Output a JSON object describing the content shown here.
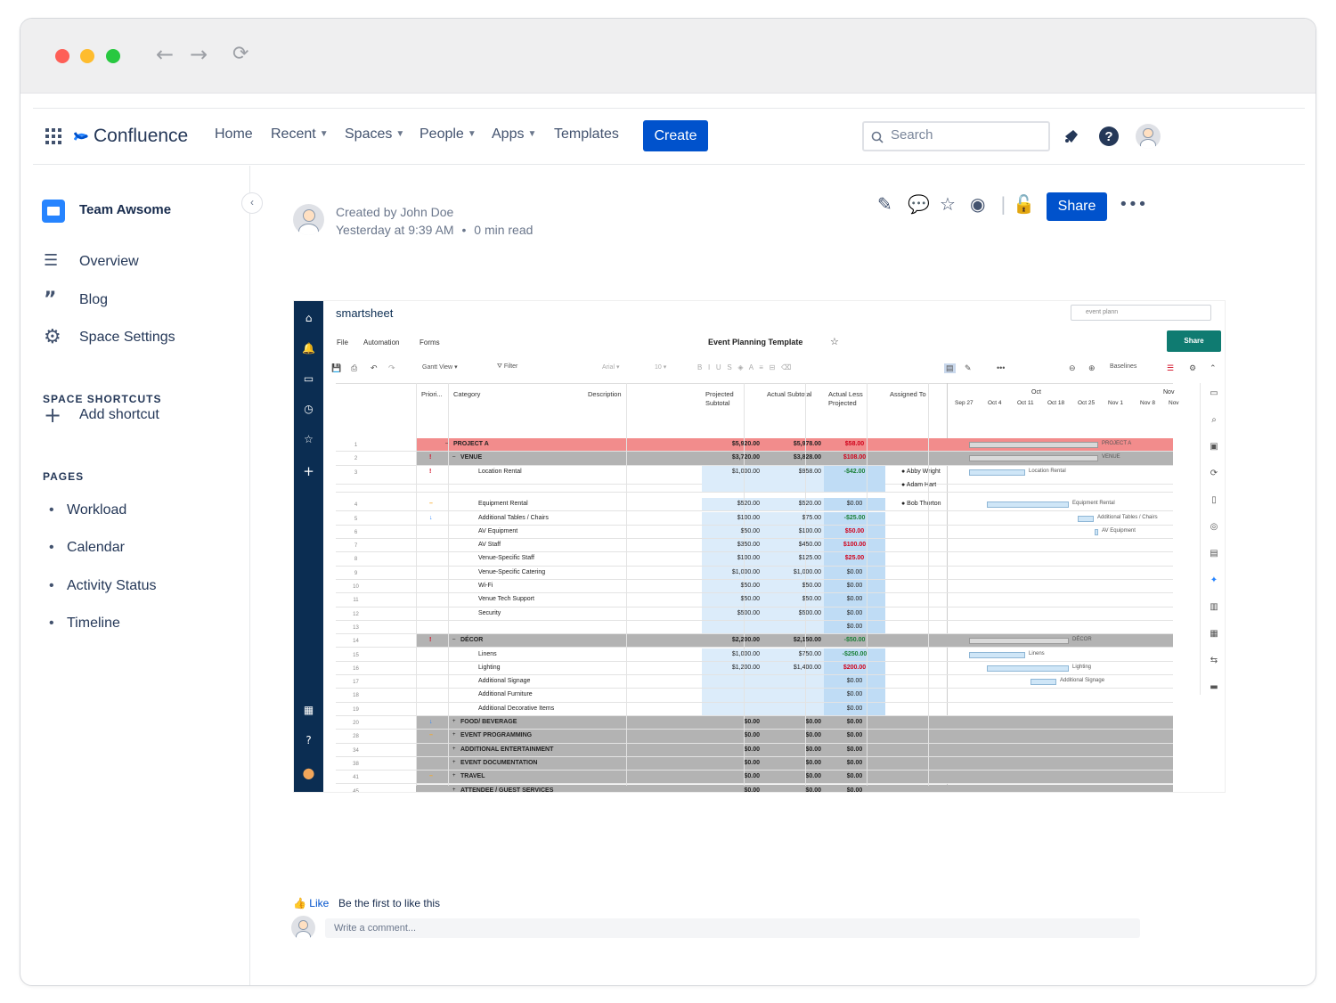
{
  "browser": {
    "back": "←",
    "forward": "→",
    "reload": "⟳"
  },
  "nav": {
    "logo": "Confluence",
    "home": "Home",
    "recent": "Recent",
    "spaces": "Spaces",
    "people": "People",
    "apps": "Apps",
    "templates": "Templates",
    "create": "Create",
    "search_placeholder": "Search"
  },
  "sidebar": {
    "space_name": "Team Awsome",
    "items": [
      {
        "label": "Overview"
      },
      {
        "label": "Blog"
      },
      {
        "label": "Space Settings"
      }
    ],
    "shortcuts_head": "SPACE SHORTCUTS",
    "add_shortcut": "Add shortcut",
    "pages_head": "PAGES",
    "pages": [
      {
        "label": "Workload"
      },
      {
        "label": "Calendar"
      },
      {
        "label": "Activity Status"
      },
      {
        "label": "Timeline"
      }
    ]
  },
  "page": {
    "created_by": "Created by John Doe",
    "timestamp": "Yesterday at 9:39 AM",
    "read_time": "0 min read",
    "share": "Share"
  },
  "smartsheet": {
    "brand": "smartsheet",
    "search_value": "event plann",
    "menu": [
      "File",
      "Automation",
      "Forms"
    ],
    "title": "Event Planning Template",
    "share": "Share",
    "toolbar": {
      "view": "Gantt View",
      "filter": "Filter",
      "font": "Arial",
      "size": "10",
      "baselines": "Baselines"
    },
    "headers": {
      "priority": "Priori...",
      "category": "Category",
      "description": "Description",
      "projected": "Projected Subtotal",
      "actual": "Actual Subtotal",
      "actual_less": "Actual Less Projected",
      "assigned": "Assigned To"
    },
    "gantt_months": [
      "Oct",
      "Nov"
    ],
    "gantt_weeks": [
      "Sep 27",
      "Oct 4",
      "Oct 11",
      "Oct 18",
      "Oct 25",
      "Nov 1",
      "Nov 8",
      "Nov"
    ],
    "rows": [
      {
        "n": "1",
        "cat": "PROJECT A",
        "ps": "$5,920.00",
        "as": "$5,978.00",
        "alp": "$58.00",
        "bar": "PROJECT A",
        "kind": "proj"
      },
      {
        "n": "2",
        "cat": "VENUE",
        "ps": "$3,720.00",
        "as": "$3,828.00",
        "alp": "$108.00",
        "bar": "VENUE",
        "kind": "group",
        "pri": "!"
      },
      {
        "n": "3",
        "cat": "Location Rental",
        "ps": "$1,000.00",
        "as": "$958.00",
        "alp": "-$42.00",
        "bar": "Location Rental",
        "kind": "child",
        "pri": "!",
        "asg": "Abby Wright"
      },
      {
        "n": "",
        "cat": "",
        "ps": "",
        "as": "",
        "alp": "",
        "bar": "",
        "kind": "child",
        "asg": "Adam Hart"
      },
      {
        "n": "4",
        "cat": "Equipment Rental",
        "ps": "$520.00",
        "as": "$520.00",
        "alp": "$0.00",
        "bar": "Equipment Rental",
        "kind": "child",
        "pri": "–",
        "asg": "Bob Thorton"
      },
      {
        "n": "5",
        "cat": "Additional Tables / Chairs",
        "ps": "$100.00",
        "as": "$75.00",
        "alp": "-$25.00",
        "bar": "Additional Tables / Chairs",
        "kind": "child",
        "pri": "↓"
      },
      {
        "n": "6",
        "cat": "AV Equipment",
        "ps": "$50.00",
        "as": "$100.00",
        "alp": "$50.00",
        "bar": "AV Equipment",
        "kind": "child"
      },
      {
        "n": "7",
        "cat": "AV Staff",
        "ps": "$350.00",
        "as": "$450.00",
        "alp": "$100.00",
        "bar": "",
        "kind": "child"
      },
      {
        "n": "8",
        "cat": "Venue-Specific Staff",
        "ps": "$100.00",
        "as": "$125.00",
        "alp": "$25.00",
        "bar": "",
        "kind": "child"
      },
      {
        "n": "9",
        "cat": "Venue-Specific Catering",
        "ps": "$1,000.00",
        "as": "$1,000.00",
        "alp": "$0.00",
        "bar": "",
        "kind": "child"
      },
      {
        "n": "10",
        "cat": "Wi-Fi",
        "ps": "$50.00",
        "as": "$50.00",
        "alp": "$0.00",
        "bar": "",
        "kind": "child"
      },
      {
        "n": "11",
        "cat": "Venue Tech Support",
        "ps": "$50.00",
        "as": "$50.00",
        "alp": "$0.00",
        "bar": "",
        "kind": "child"
      },
      {
        "n": "12",
        "cat": "Security",
        "ps": "$500.00",
        "as": "$500.00",
        "alp": "$0.00",
        "bar": "",
        "kind": "child"
      },
      {
        "n": "13",
        "cat": "",
        "ps": "",
        "as": "",
        "alp": "$0.00",
        "bar": "",
        "kind": "child"
      },
      {
        "n": "14",
        "cat": "DÉCOR",
        "ps": "$2,200.00",
        "as": "$2,150.00",
        "alp": "-$50.00",
        "bar": "DÉCOR",
        "kind": "group",
        "pri": "!"
      },
      {
        "n": "15",
        "cat": "Linens",
        "ps": "$1,000.00",
        "as": "$750.00",
        "alp": "-$250.00",
        "bar": "Linens",
        "kind": "child"
      },
      {
        "n": "16",
        "cat": "Lighting",
        "ps": "$1,200.00",
        "as": "$1,400.00",
        "alp": "$200.00",
        "bar": "Lighting",
        "kind": "child"
      },
      {
        "n": "17",
        "cat": "Additional Signage",
        "ps": "",
        "as": "",
        "alp": "$0.00",
        "bar": "Additional Signage",
        "kind": "child"
      },
      {
        "n": "18",
        "cat": "Additional Furniture",
        "ps": "",
        "as": "",
        "alp": "$0.00",
        "bar": "",
        "kind": "child"
      },
      {
        "n": "19",
        "cat": "Additional Decorative Items",
        "ps": "",
        "as": "",
        "alp": "$0.00",
        "bar": "",
        "kind": "child"
      },
      {
        "n": "20",
        "cat": "FOOD/ BEVERAGE",
        "ps": "$0.00",
        "as": "$0.00",
        "alp": "$0.00",
        "bar": "",
        "kind": "collapsed",
        "pri": "↓"
      },
      {
        "n": "28",
        "cat": "EVENT PROGRAMMING",
        "ps": "$0.00",
        "as": "$0.00",
        "alp": "$0.00",
        "bar": "",
        "kind": "collapsed",
        "pri": "–"
      },
      {
        "n": "34",
        "cat": "ADDITIONAL ENTERTAINMENT",
        "ps": "$0.00",
        "as": "$0.00",
        "alp": "$0.00",
        "bar": "",
        "kind": "collapsed"
      },
      {
        "n": "38",
        "cat": "EVENT DOCUMENTATION",
        "ps": "$0.00",
        "as": "$0.00",
        "alp": "$0.00",
        "bar": "",
        "kind": "collapsed"
      },
      {
        "n": "41",
        "cat": "TRAVEL",
        "ps": "$0.00",
        "as": "$0.00",
        "alp": "$0.00",
        "bar": "",
        "kind": "collapsed",
        "pri": "–"
      },
      {
        "n": "45",
        "cat": "ATTENDEE / GUEST SERVICES",
        "ps": "$0.00",
        "as": "$0.00",
        "alp": "$0.00",
        "bar": "",
        "kind": "collapsed"
      }
    ]
  },
  "footer": {
    "like": "Like",
    "like_text": "Be the first to like this",
    "comment_placeholder": "Write a comment..."
  },
  "colors": {
    "primary": "#0052cc",
    "rail": "#0b2d52",
    "project_row": "#f28c8c",
    "group_row": "#b3b3b3",
    "projected_col": "#dcecfa",
    "negative": "#1a7f37",
    "positive": "#d0021b"
  }
}
